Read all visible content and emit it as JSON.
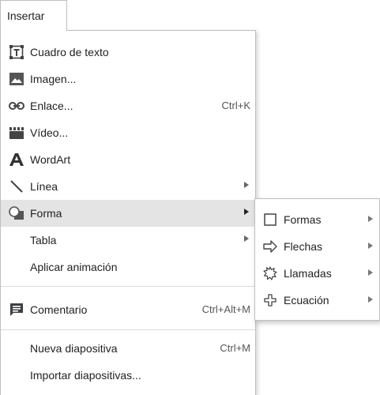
{
  "menubar": {
    "active_menu": "Insertar"
  },
  "menu": {
    "items": [
      {
        "label": "Cuadro de texto",
        "icon": "text-box-icon"
      },
      {
        "label": "Imagen...",
        "icon": "image-icon"
      },
      {
        "label": "Enlace...",
        "shortcut": "Ctrl+K",
        "icon": "link-icon"
      },
      {
        "label": "Vídeo...",
        "icon": "video-icon"
      },
      {
        "label": "WordArt",
        "icon": "wordart-icon"
      },
      {
        "label": "Línea",
        "icon": "line-icon",
        "has_submenu": true
      },
      {
        "label": "Forma",
        "icon": "shape-icon",
        "has_submenu": true,
        "active": true
      },
      {
        "label": "Tabla",
        "has_submenu": true
      },
      {
        "label": "Aplicar animación"
      },
      {
        "label": "Comentario",
        "shortcut": "Ctrl+Alt+M",
        "icon": "comment-icon"
      },
      {
        "label": "Nueva diapositiva",
        "shortcut": "Ctrl+M"
      },
      {
        "label": "Importar diapositivas..."
      }
    ]
  },
  "submenu": {
    "items": [
      {
        "label": "Formas",
        "icon": "rectangle-icon",
        "has_submenu": true
      },
      {
        "label": "Flechas",
        "icon": "arrow-shape-icon",
        "has_submenu": true
      },
      {
        "label": "Llamadas",
        "icon": "callout-icon",
        "has_submenu": true
      },
      {
        "label": "Ecuación",
        "icon": "plus-shape-icon",
        "has_submenu": true
      }
    ]
  },
  "colors": {
    "active_bg": "#e4e4e4",
    "border": "#bfbfbf",
    "icon": "#444444",
    "comment_icon": "#3c4043"
  }
}
